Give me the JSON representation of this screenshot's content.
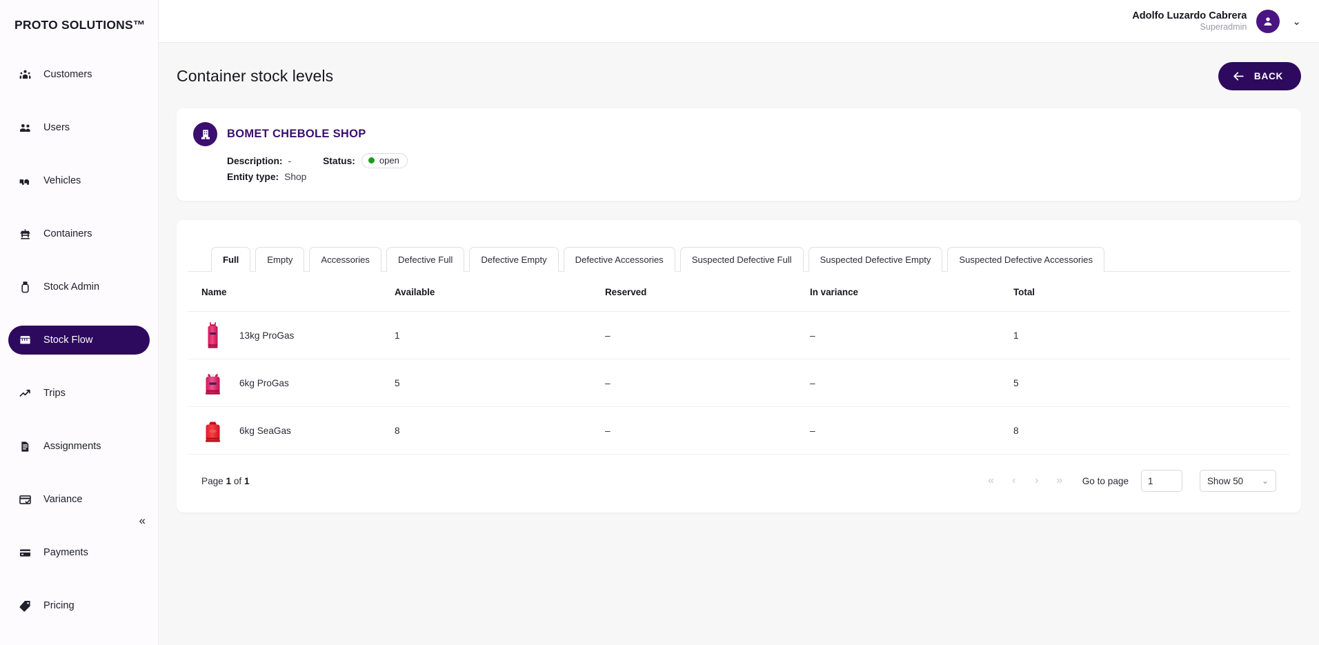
{
  "brand": {
    "name": "PROTO SOLUTIONS™"
  },
  "sidebar": {
    "items": [
      {
        "label": "Customers",
        "icon": "customers-icon",
        "active": false
      },
      {
        "label": "Users",
        "icon": "users-icon",
        "active": false
      },
      {
        "label": "Vehicles",
        "icon": "vehicles-icon",
        "active": false
      },
      {
        "label": "Containers",
        "icon": "containers-icon",
        "active": false
      },
      {
        "label": "Stock Admin",
        "icon": "stock-admin-icon",
        "active": false
      },
      {
        "label": "Stock Flow",
        "icon": "stock-flow-icon",
        "active": true
      },
      {
        "label": "Trips",
        "icon": "trips-icon",
        "active": false
      },
      {
        "label": "Assignments",
        "icon": "assignments-icon",
        "active": false
      },
      {
        "label": "Variance",
        "icon": "variance-icon",
        "active": false
      },
      {
        "label": "Payments",
        "icon": "payments-icon",
        "active": false
      },
      {
        "label": "Pricing",
        "icon": "pricing-icon",
        "active": false
      }
    ],
    "collapse_glyph": "«",
    "active_color": "#2d0a5e"
  },
  "topbar": {
    "user_name": "Adolfo Luzardo Cabrera",
    "user_role": "Superadmin",
    "caret_glyph": "⌄"
  },
  "page": {
    "title": "Container stock levels",
    "back_label": "BACK"
  },
  "entity": {
    "name": "BOMET CHEBOLE SHOP",
    "description_label": "Description:",
    "description_value": "-",
    "status_label": "Status:",
    "status_value": "open",
    "status_color": "#1a9c1a",
    "entity_type_label": "Entity type:",
    "entity_type_value": "Shop"
  },
  "tabs": [
    {
      "label": "Full",
      "active": true
    },
    {
      "label": "Empty",
      "active": false
    },
    {
      "label": "Accessories",
      "active": false
    },
    {
      "label": "Defective Full",
      "active": false
    },
    {
      "label": "Defective Empty",
      "active": false
    },
    {
      "label": "Defective Accessories",
      "active": false
    },
    {
      "label": "Suspected Defective Full",
      "active": false
    },
    {
      "label": "Suspected Defective Empty",
      "active": false
    },
    {
      "label": "Suspected Defective Accessories",
      "active": false
    }
  ],
  "table": {
    "columns": [
      "Name",
      "Available",
      "Reserved",
      "In variance",
      "Total"
    ],
    "rows": [
      {
        "name": "13kg ProGas",
        "available": "1",
        "reserved": "–",
        "in_variance": "–",
        "total": "1",
        "image": "gas-cylinder-tall-pink"
      },
      {
        "name": "6kg ProGas",
        "available": "5",
        "reserved": "–",
        "in_variance": "–",
        "total": "5",
        "image": "gas-cylinder-short-pink"
      },
      {
        "name": "6kg SeaGas",
        "available": "8",
        "reserved": "–",
        "in_variance": "–",
        "total": "8",
        "image": "gas-cylinder-short-red"
      }
    ]
  },
  "pagination": {
    "page_prefix": "Page",
    "current_page": "1",
    "of_text": "of",
    "total_pages": "1",
    "first_glyph": "«",
    "prev_glyph": "‹",
    "next_glyph": "›",
    "last_glyph": "»",
    "goto_label": "Go to page",
    "goto_value": "1",
    "page_size_label": "Show 50",
    "chevron_glyph": "⌄"
  }
}
